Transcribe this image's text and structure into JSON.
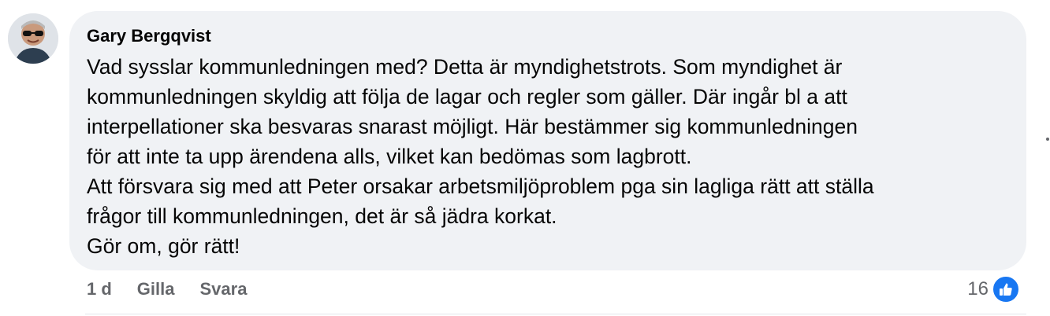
{
  "comment": {
    "author": "Gary Bergqvist",
    "lines": [
      "Vad sysslar kommunledningen med? Detta är myndighetstrots. Som myndighet är",
      "kommunledningen skyldig att följa de lagar och regler som gäller. Där ingår bl a att",
      "interpellationer ska besvaras snarast möjligt. Här bestämmer sig kommunledningen",
      "för att inte ta upp ärendena alls, vilket kan bedömas som lagbrott.",
      "Att försvara sig med att Peter orsakar arbetsmiljöproblem pga sin lagliga rätt att ställa",
      "frågor till kommunledningen, det är så jädra korkat.",
      "Gör om, gör rätt!"
    ],
    "timestamp": "1 d",
    "like_label": "Gilla",
    "reply_label": "Svara",
    "reaction_count": "16"
  },
  "icons": {
    "avatar": "avatar-photo",
    "reaction": "thumbs-up-icon",
    "more": "more-options-icon"
  },
  "colors": {
    "bubble": "#f0f2f5",
    "secondary_text": "#65676b",
    "like_blue": "#1877f2"
  }
}
